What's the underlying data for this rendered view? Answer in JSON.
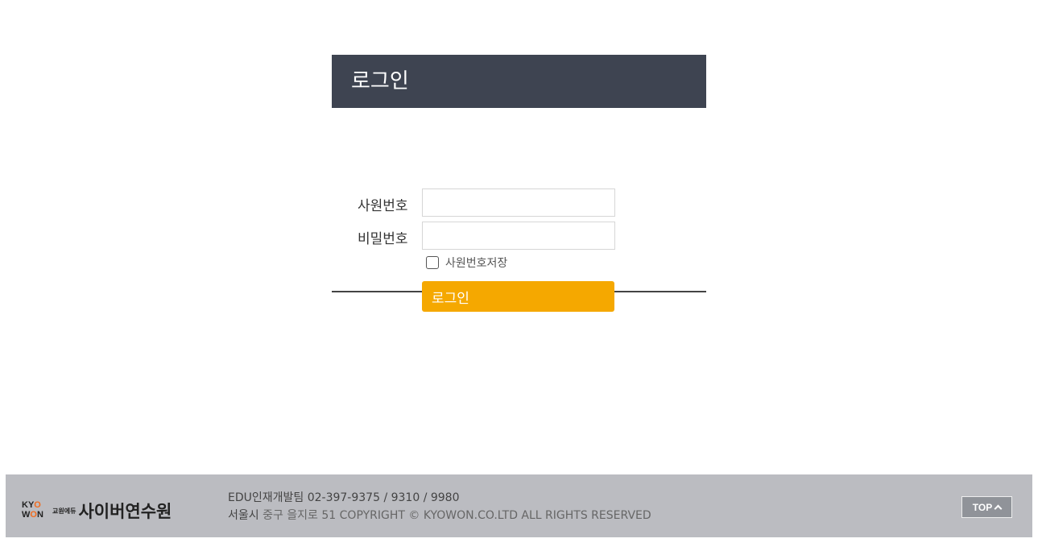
{
  "login": {
    "title": "로그인",
    "employee_id_label": "사원번호",
    "employee_id_value": "",
    "password_label": "비밀번호",
    "password_value": "",
    "save_id_label": "사원번호저장",
    "save_id_checked": false,
    "submit_label": "로그인"
  },
  "footer": {
    "logo_ky": "KY",
    "logo_o1": "O",
    "logo_w": "W",
    "logo_o2": "O",
    "logo_n": "N",
    "logo_small": "교원에듀",
    "logo_title": "사이버연수원",
    "contact": "EDU인재개발팀 02-397-9375 / 9310 / 9980",
    "address_city": "서울시",
    "address_rest": " 중구 을지로 51 COPYRIGHT © KYOWON.CO.LTD ALL RIGHTS RESERVED",
    "top_button_label": "TOP"
  },
  "colors": {
    "header_bg": "#3e4451",
    "button_accent": "#f5a800",
    "footer_bg": "#bbbcc1",
    "logo_orange": "#f26b1d"
  }
}
